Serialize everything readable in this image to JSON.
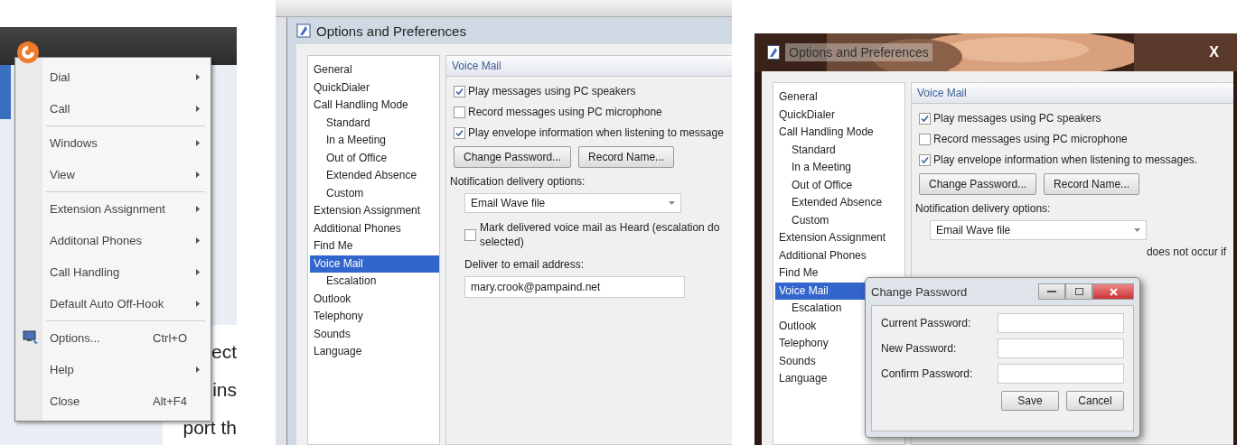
{
  "menu_screen": {
    "menu": {
      "items": [
        {
          "kind": "item",
          "label": "Dial",
          "submenu": true
        },
        {
          "kind": "item",
          "label": "Call",
          "submenu": true
        },
        {
          "kind": "separator"
        },
        {
          "kind": "item",
          "label": "Windows",
          "submenu": true
        },
        {
          "kind": "item",
          "label": "View",
          "submenu": true
        },
        {
          "kind": "separator"
        },
        {
          "kind": "item",
          "label": "Extension Assignment",
          "submenu": true
        },
        {
          "kind": "item",
          "label": "Additonal Phones",
          "submenu": true
        },
        {
          "kind": "item",
          "label": "Call Handling",
          "submenu": true
        },
        {
          "kind": "item",
          "label": "Default Auto Off-Hook",
          "submenu": true
        },
        {
          "kind": "separator"
        },
        {
          "kind": "icon_item",
          "label": "Options...",
          "shortcut": "Ctrl+O",
          "submenu": false
        },
        {
          "kind": "item",
          "label": "Help",
          "submenu": true
        },
        {
          "kind": "item",
          "label": "Close",
          "shortcut": "Alt+F4",
          "submenu": false
        }
      ]
    },
    "background_texts": [
      "ect",
      "ins",
      "port th"
    ]
  },
  "options_window": {
    "title": "Options and Preferences",
    "sidebar": [
      {
        "label": "General",
        "selected": false
      },
      {
        "label": "QuickDialer",
        "selected": false
      },
      {
        "label": "Call Handling Mode",
        "selected": false,
        "children": [
          {
            "label": "Standard",
            "selected": false
          },
          {
            "label": "In a Meeting",
            "selected": false
          },
          {
            "label": "Out of Office",
            "selected": false
          },
          {
            "label": "Extended Absence",
            "selected": false
          },
          {
            "label": "Custom",
            "selected": false
          }
        ]
      },
      {
        "label": "Extension Assignment",
        "selected": false
      },
      {
        "label": "Additional Phones",
        "selected": false
      },
      {
        "label": "Find Me",
        "selected": false
      },
      {
        "label": "Voice Mail",
        "selected": true,
        "children": [
          {
            "label": "Escalation",
            "selected": false
          }
        ]
      },
      {
        "label": "Outlook",
        "selected": false
      },
      {
        "label": "Telephony",
        "selected": false
      },
      {
        "label": "Sounds",
        "selected": false
      },
      {
        "label": "Language",
        "selected": false
      }
    ],
    "section": "Voice Mail",
    "checkboxes": [
      {
        "label": "Play messages using PC speakers",
        "checked": true
      },
      {
        "label": "Record messages using PC microphone",
        "checked": false
      },
      {
        "label": "Play envelope information when listening to message",
        "checked": true
      }
    ],
    "buttons": [
      "Change Password...",
      "Record Name..."
    ],
    "notification_label": "Notification delivery options:",
    "dropdown": {
      "value": "Email Wave file"
    },
    "mark_checkbox": {
      "label": "Mark delivered voice mail as Heard (escalation do",
      "label_line2": "selected)",
      "checked": false
    },
    "email_label": "Deliver to email address:",
    "email_value": "mary.crook@pampaind.net"
  },
  "options_window_2": {
    "title": "Options and Preferences",
    "close": "X",
    "sidebar": [
      {
        "label": "General",
        "selected": false
      },
      {
        "label": "QuickDialer",
        "selected": false
      },
      {
        "label": "Call Handling Mode",
        "selected": false,
        "children": [
          {
            "label": "Standard",
            "selected": false
          },
          {
            "label": "In a Meeting",
            "selected": false
          },
          {
            "label": "Out of Office",
            "selected": false
          },
          {
            "label": "Extended Absence",
            "selected": false
          },
          {
            "label": "Custom",
            "selected": false
          }
        ]
      },
      {
        "label": "Extension Assignment",
        "selected": false
      },
      {
        "label": "Additional Phones",
        "selected": false
      },
      {
        "label": "Find Me",
        "selected": false
      },
      {
        "label": "Voice Mail",
        "selected": true,
        "children": [
          {
            "label": "Escalation",
            "selected": false
          }
        ]
      },
      {
        "label": "Outlook",
        "selected": false
      },
      {
        "label": "Telephony",
        "selected": false
      },
      {
        "label": "Sounds",
        "selected": false
      },
      {
        "label": "Language",
        "selected": false
      }
    ],
    "section": "Voice Mail",
    "checkboxes": [
      {
        "label": "Play messages using PC speakers",
        "checked": true
      },
      {
        "label": "Record messages using PC microphone",
        "checked": false
      },
      {
        "label": "Play envelope information when listening to messages.",
        "checked": true
      }
    ],
    "buttons": [
      "Change Password...",
      "Record Name..."
    ],
    "notification_label": "Notification delivery options:",
    "dropdown": {
      "value": "Email Wave file"
    },
    "covered_text": "does not occur if",
    "dialog": {
      "title": "Change Password",
      "fields": [
        {
          "label": "Current Password:"
        },
        {
          "label": "New Password:"
        },
        {
          "label": "Confirm Password:"
        }
      ],
      "buttons": [
        "Save",
        "Cancel"
      ]
    }
  }
}
